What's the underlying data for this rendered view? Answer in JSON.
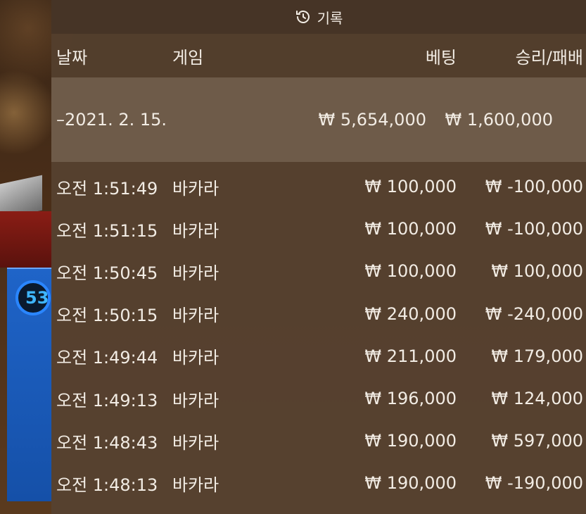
{
  "background": {
    "timer_text": "53"
  },
  "panel": {
    "title": "기록",
    "icon": "history-icon",
    "columns": {
      "date": "날짜",
      "game": "게임",
      "bet": "베팅",
      "winloss": "승리/패배"
    },
    "summary": {
      "date": "–2021. 2. 15.",
      "bet": "₩ 5,654,000",
      "winloss": "₩ 1,600,000"
    },
    "rows": [
      {
        "time": "오전 1:51:49",
        "game": "바카라",
        "bet": "₩ 100,000",
        "winloss": "₩ -100,000"
      },
      {
        "time": "오전 1:51:15",
        "game": "바카라",
        "bet": "₩ 100,000",
        "winloss": "₩ -100,000"
      },
      {
        "time": "오전 1:50:45",
        "game": "바카라",
        "bet": "₩ 100,000",
        "winloss": "₩ 100,000"
      },
      {
        "time": "오전 1:50:15",
        "game": "바카라",
        "bet": "₩ 240,000",
        "winloss": "₩ -240,000"
      },
      {
        "time": "오전 1:49:44",
        "game": "바카라",
        "bet": "₩ 211,000",
        "winloss": "₩ 179,000"
      },
      {
        "time": "오전 1:49:13",
        "game": "바카라",
        "bet": "₩ 196,000",
        "winloss": "₩ 124,000"
      },
      {
        "time": "오전 1:48:43",
        "game": "바카라",
        "bet": "₩ 190,000",
        "winloss": "₩ 597,000"
      },
      {
        "time": "오전 1:48:13",
        "game": "바카라",
        "bet": "₩ 190,000",
        "winloss": "₩ -190,000"
      }
    ]
  }
}
